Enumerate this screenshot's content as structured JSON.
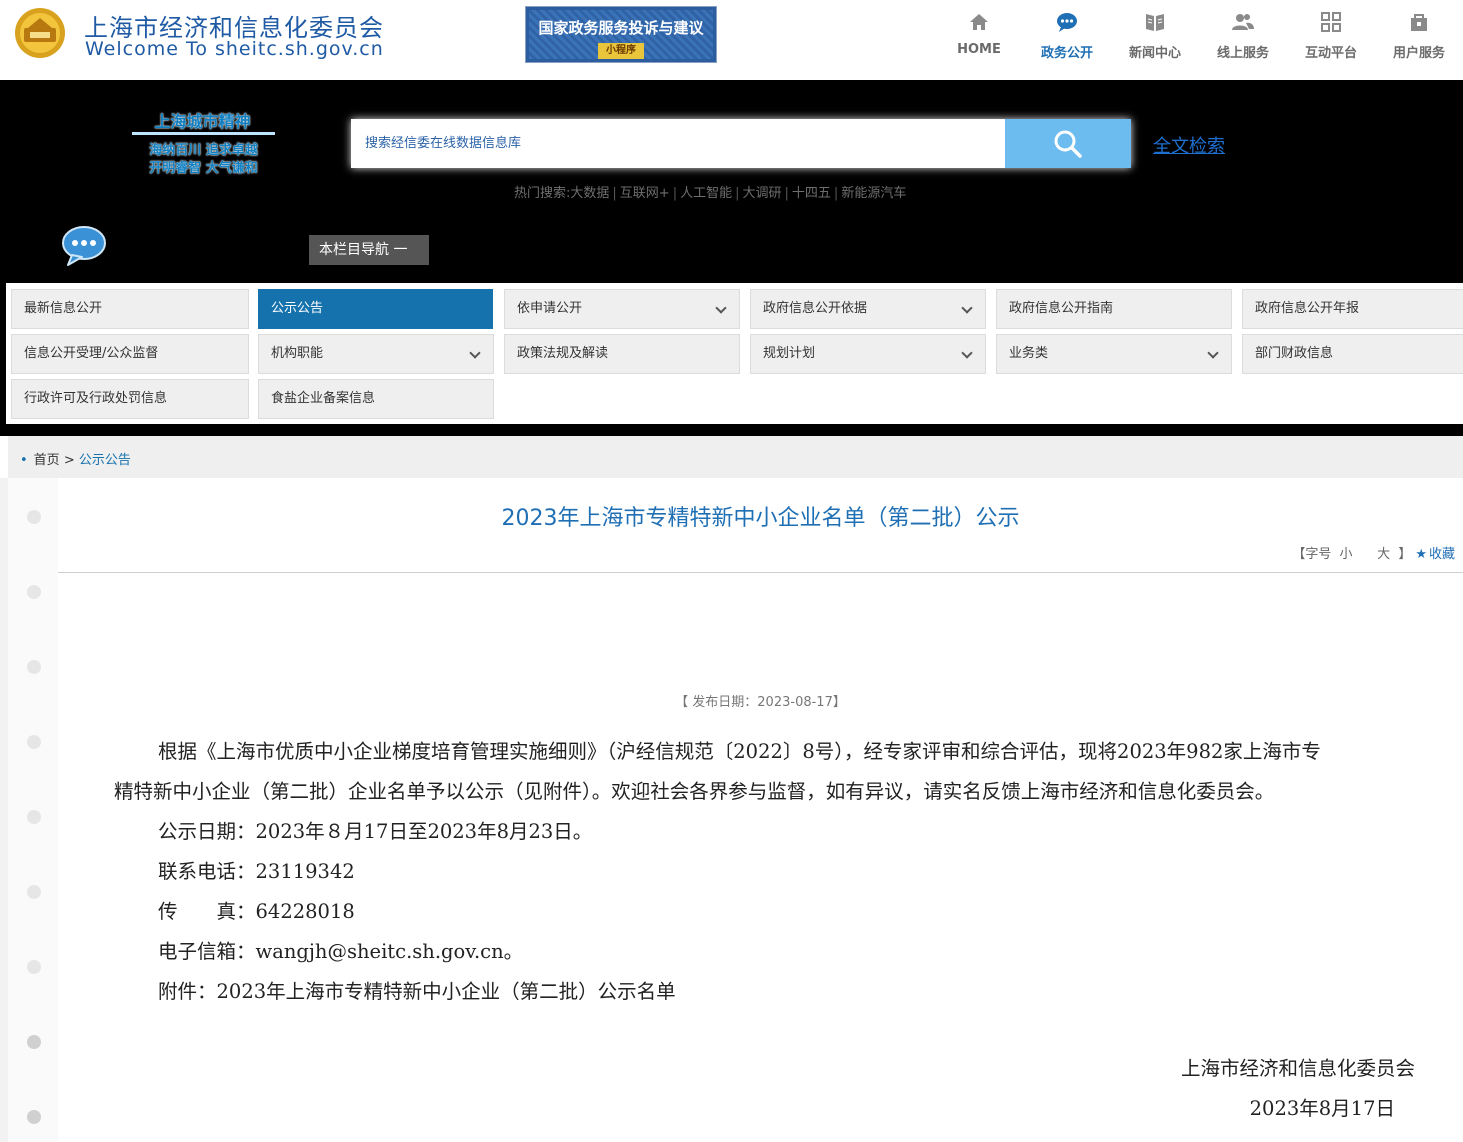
{
  "header": {
    "site_title_cn": "上海市经济和信息化委员会",
    "site_title_en": "Welcome To sheitc.sh.gov.cn",
    "banner_title": "国家政务服务投诉与建议",
    "banner_sub": "小程序",
    "nav": [
      {
        "label": "HOME",
        "icon": "home-icon"
      },
      {
        "label": "政务公开",
        "icon": "chat-icon"
      },
      {
        "label": "新闻中心",
        "icon": "book-icon"
      },
      {
        "label": "线上服务",
        "icon": "users-icon"
      },
      {
        "label": "互动平台",
        "icon": "grid-icon"
      },
      {
        "label": "用户服务",
        "icon": "bag-icon"
      }
    ],
    "active_nav": "政务公开"
  },
  "spirit": {
    "title": "上海城市精神",
    "line1": "海纳百川 追求卓越",
    "line2": "开明睿智 大气谦和"
  },
  "search": {
    "placeholder": "搜索经信委在线数据信息库",
    "fulltext_label": "全文检索",
    "hot_label": "热门搜索:",
    "hot_items": [
      "大数据",
      "互联网+",
      "人工智能",
      "大调研",
      "十四五",
      "新能源汽车"
    ]
  },
  "section_nav_label": "本栏目导航 一",
  "categories": [
    {
      "label": "最新信息公开",
      "dropdown": false
    },
    {
      "label": "公示公告",
      "dropdown": false,
      "active": true
    },
    {
      "label": "依申请公开",
      "dropdown": true
    },
    {
      "label": "政府信息公开依据",
      "dropdown": true
    },
    {
      "label": "政府信息公开指南",
      "dropdown": false
    },
    {
      "label": "政府信息公开年报",
      "dropdown": false
    },
    {
      "label": "信息公开受理/公众监督",
      "dropdown": false
    },
    {
      "label": "机构职能",
      "dropdown": true
    },
    {
      "label": "政策法规及解读",
      "dropdown": false
    },
    {
      "label": "规划计划",
      "dropdown": true
    },
    {
      "label": "业务类",
      "dropdown": true
    },
    {
      "label": "部门财政信息",
      "dropdown": false
    },
    {
      "label": "行政许可及行政处罚信息",
      "dropdown": false
    },
    {
      "label": "食盐企业备案信息",
      "dropdown": false
    }
  ],
  "breadcrumb": {
    "home": "首页",
    "sep": ">",
    "current": "公示公告"
  },
  "article": {
    "title": "2023年上海市专精特新中小企业名单（第二批）公示",
    "font_label_open": "【字号",
    "font_small": "小",
    "font_large": "大",
    "font_label_close": "】",
    "favorite": "收藏",
    "pub_date": "【 发布日期：2023-08-17】",
    "para1_line1": "根据《上海市优质中小企业梯度培育管理实施细则》（沪经信规范〔2022〕8号），经专家评审和综合评估，现将2023年982家上海市专",
    "para1_line2": "精特新中小企业（第二批）企业名单予以公示（见附件）。欢迎社会各界参与监督，如有异议，请实名反馈上海市经济和信息化委员会。",
    "period": "公示日期：2023年８月17日至2023年8月23日。",
    "phone": "联系电话：23119342",
    "fax": "传　　真：64228018",
    "email": "电子信箱：wangjh@sheitc.sh.gov.cn。",
    "attachment": "附件：2023年上海市专精特新中小企业（第二批）公示名单",
    "sign_org": "上海市经济和信息化委员会",
    "sign_date": "2023年8月17日"
  },
  "colors": {
    "brand_blue": "#1f6fb5",
    "active_tab": "#1672ad",
    "search_button": "#6cbcf0"
  }
}
